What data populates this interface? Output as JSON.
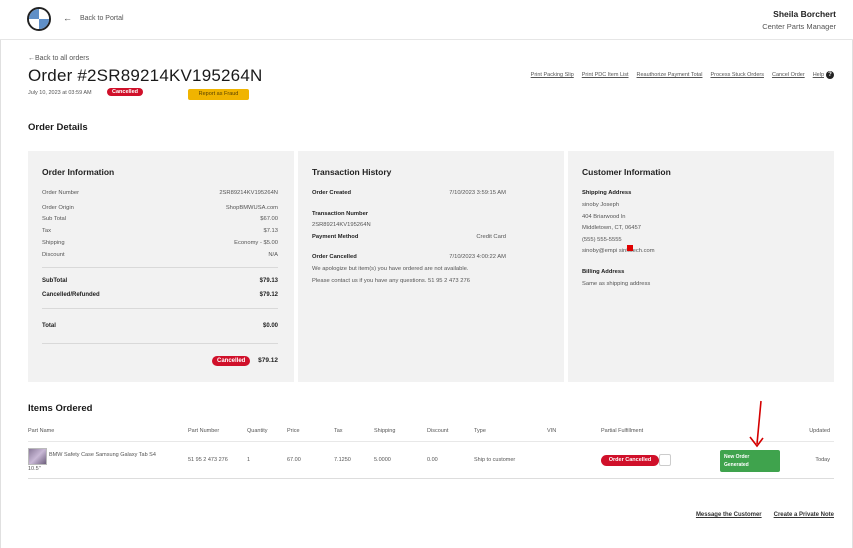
{
  "header": {
    "back_portal": "Back to Portal",
    "user_name": "Sheila Borchert",
    "user_role": "Center Parts Manager"
  },
  "order": {
    "back_link": "Back to all orders",
    "title": "Order #2SR89214KV195264N",
    "date": "July 10, 2023 at 03:59 AM",
    "status_badge": "Cancelled",
    "fraud_button": "Report as Fraud"
  },
  "actions": [
    "Print Packing Slip",
    "Print PDC Item List",
    "Reauthorize Payment Total",
    "Process Stuck Orders",
    "Cancel Order",
    "Help"
  ],
  "section_order_details": "Order Details",
  "order_info": {
    "title": "Order Information",
    "rows": [
      {
        "label": "Order Number",
        "value": "2SR89214KV195264N"
      },
      {
        "label": "Order Origin",
        "value": "ShopBMWUSA.com"
      },
      {
        "label": "Sub Total",
        "value": "$67.00"
      },
      {
        "label": "Tax",
        "value": "$7.13"
      },
      {
        "label": "Shipping",
        "value": "Economy - $5.00"
      },
      {
        "label": "Discount",
        "value": "N/A"
      }
    ],
    "subtotal_label": "SubTotal",
    "subtotal_value": "$79.13",
    "refunded_label": "Cancelled/Refunded",
    "refunded_value": "$79.12",
    "total_label": "Total",
    "total_value": "$0.00",
    "final_badge": "Cancelled",
    "final_value": "$79.12"
  },
  "transaction": {
    "title": "Transaction History",
    "created_label": "Order Created",
    "created_value": "7/10/2023 3:59:15 AM",
    "txn_label": "Transaction Number",
    "txn_value": "2SR89214KV195264N",
    "payment_label": "Payment Method",
    "payment_value": "Credit Card",
    "cancelled_label": "Order Cancelled",
    "cancelled_value": "7/10/2023 4:00:22 AM",
    "note_line1": "We apologize but item(s) you have ordered are not available.",
    "note_line2": "Please contact us if you have any questions. 51 95 2 473 276"
  },
  "customer": {
    "title": "Customer Information",
    "shipping_label": "Shipping Address",
    "name": "sinoby Joseph",
    "street": "404 Briarwood ln",
    "city": "Middletown, CT, 06457",
    "phone": "(555) 555-5555",
    "email": "sinoby@empi  sinfotech.com",
    "billing_label": "Billing Address",
    "billing_value": "Same as shipping address"
  },
  "items_section": "Items Ordered",
  "items_columns": [
    "Part Name",
    "Part Number",
    "Quantity",
    "Price",
    "Tax",
    "Shipping",
    "Discount",
    "Type",
    "VIN",
    "Partial Fulfillment",
    "Updated"
  ],
  "item": {
    "name_line1": "BMW Safety Case Samsung Galaxy Tab S4",
    "name_line2": "10.5\"",
    "part_number": "51 95 2 473 276",
    "quantity": "1",
    "price": "67.00",
    "tax": "7.1250",
    "shipping": "5.0000",
    "discount": "0.00",
    "type": "Ship to customer",
    "status": "Order Cancelled",
    "generate_line1": "New Order",
    "generate_line2": "Generated",
    "updated": "Today"
  },
  "bottom_links": [
    "Message the Customer",
    "Create a Private Note"
  ],
  "colors": {
    "cancel_red": "#d0102a",
    "fraud_yellow": "#f0b400",
    "generated_green": "#3fa34d"
  }
}
